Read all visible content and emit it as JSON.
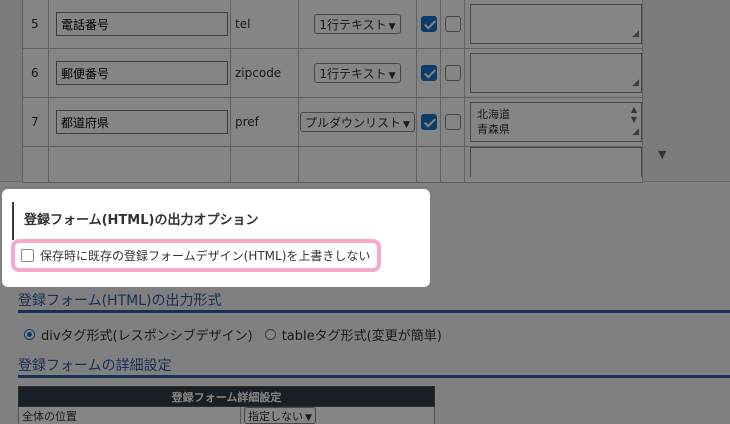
{
  "fields_table": {
    "rows": [
      {
        "no": "5",
        "name": "電話番号",
        "key": "tel",
        "type": "1行テキスト",
        "checked": true,
        "option_text": ""
      },
      {
        "no": "6",
        "name": "郵便番号",
        "key": "zipcode",
        "type": "1行テキスト",
        "checked": true,
        "option_text": ""
      },
      {
        "no": "7",
        "name": "都道府県",
        "key": "pref",
        "type": "プルダウンリスト",
        "checked": true,
        "option_lines": [
          "北海道",
          "青森県"
        ]
      }
    ]
  },
  "options_panel": {
    "title": "登録フォーム(HTML)の出力オプション",
    "checkbox_label": "保存時に既存の登録フォームデザイン(HTML)を上書きしない",
    "checked": false
  },
  "format_section": {
    "heading": "登録フォーム(HTML)の出力形式",
    "options": [
      "divタグ形式(レスポンシブデザイン)",
      "tableタグ形式(変更が簡単)"
    ],
    "selected": 0
  },
  "detail_section": {
    "heading": "登録フォームの詳細設定",
    "table_header": "登録フォーム詳細設定",
    "row_label": "全体の位置",
    "row_value": "指定しない"
  },
  "colors": {
    "accent": "#2b5fa0",
    "highlight": "#f8a8c8",
    "checkbox_on": "#1a73c9"
  }
}
